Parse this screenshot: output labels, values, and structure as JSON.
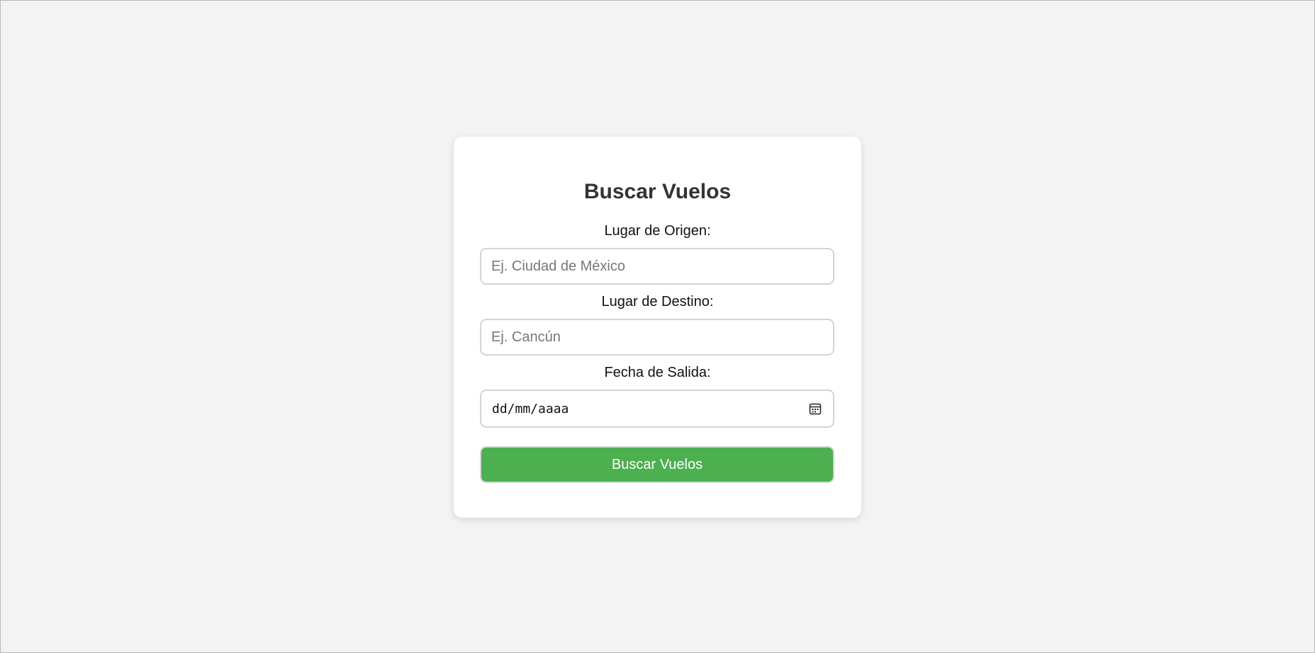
{
  "form": {
    "title": "Buscar Vuelos",
    "origin": {
      "label": "Lugar de Origen:",
      "placeholder": "Ej. Ciudad de México",
      "value": ""
    },
    "destination": {
      "label": "Lugar de Destino:",
      "placeholder": "Ej. Cancún",
      "value": ""
    },
    "departure_date": {
      "label": "Fecha de Salida:",
      "display": "dd/mm/aaaa",
      "icon": "calendar-icon"
    },
    "submit_label": "Buscar Vuelos",
    "accent_color": "#4caf50"
  }
}
